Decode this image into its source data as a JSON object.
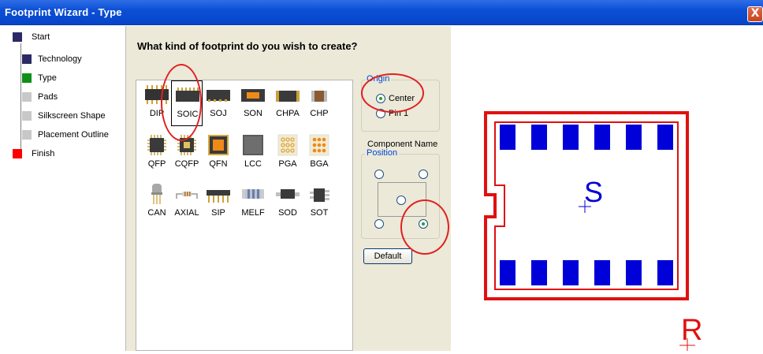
{
  "window": {
    "title": "Footprint Wizard - Type",
    "close_glyph": "X"
  },
  "steps": [
    {
      "label": "Start",
      "color": "#2b2a66"
    },
    {
      "label": "Technology",
      "color": "#2b2a66"
    },
    {
      "label": "Type",
      "color": "#0e8f16"
    },
    {
      "label": "Pads",
      "color": "#c8c8c8"
    },
    {
      "label": "Silkscreen Shape",
      "color": "#c8c8c8"
    },
    {
      "label": "Placement Outline",
      "color": "#c8c8c8"
    },
    {
      "label": "Finish",
      "color": "#ff0000"
    }
  ],
  "main": {
    "question": "What kind of footprint do you wish to create?"
  },
  "packages": [
    [
      "DIP",
      "SOIC",
      "SOJ",
      "SON",
      "CHPA",
      "CHP"
    ],
    [
      "QFP",
      "CQFP",
      "QFN",
      "LCC",
      "PGA",
      "BGA"
    ],
    [
      "CAN",
      "AXIAL",
      "SIP",
      "MELF",
      "SOD",
      "SOT"
    ]
  ],
  "selected_package": "SOIC",
  "origin": {
    "title": "Origin",
    "options": [
      "Center",
      "Pin 1"
    ],
    "selected": "Center"
  },
  "component_name": {
    "label": "Component Name",
    "position_title": "Position",
    "selected": "bottom-right"
  },
  "buttons": {
    "default": "Default"
  },
  "preview": {
    "top_designator": "S",
    "bottom_designator": "R"
  },
  "colors": {
    "accent": "#0046d5",
    "pad": "#0000d8",
    "outline": "#e01010",
    "annotation": "#e02020"
  }
}
